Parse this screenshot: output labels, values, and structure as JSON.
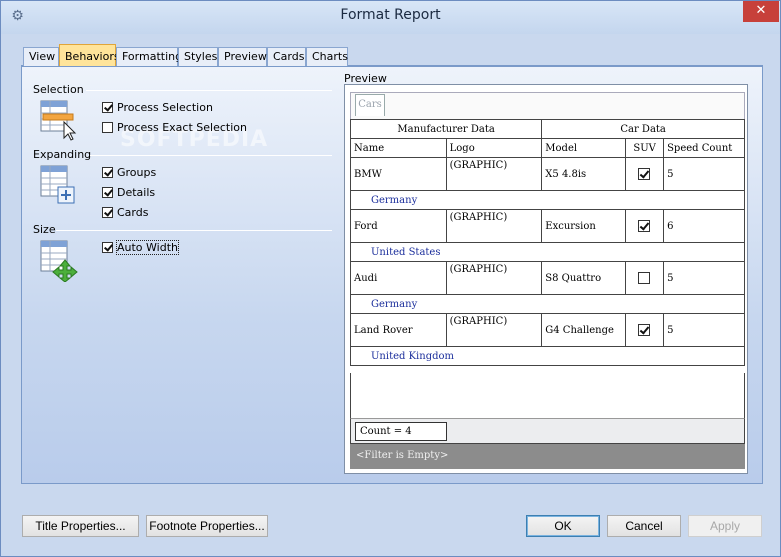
{
  "window": {
    "title": "Format Report",
    "close_label": "✕"
  },
  "tabs": [
    {
      "label": "View",
      "active": false
    },
    {
      "label": "Behaviors",
      "active": true
    },
    {
      "label": "Formatting",
      "active": false
    },
    {
      "label": "Styles",
      "active": false
    },
    {
      "label": "Preview",
      "active": false
    },
    {
      "label": "Cards",
      "active": false
    },
    {
      "label": "Charts",
      "active": false
    }
  ],
  "watermark": "SOFTPEDIA",
  "behaviors": {
    "selection": {
      "label": "Selection",
      "options": [
        {
          "label": "Process Selection",
          "checked": true
        },
        {
          "label": "Process Exact Selection",
          "checked": false
        }
      ]
    },
    "expanding": {
      "label": "Expanding",
      "options": [
        {
          "label": "Groups",
          "checked": true
        },
        {
          "label": "Details",
          "checked": true
        },
        {
          "label": "Cards",
          "checked": true
        }
      ]
    },
    "size": {
      "label": "Size",
      "options": [
        {
          "label": "Auto Width",
          "checked": true
        }
      ]
    }
  },
  "preview": {
    "label": "Preview",
    "card_tab": "Cars",
    "group_headers": [
      "Manufacturer Data",
      "Car Data"
    ],
    "columns": [
      "Name",
      "Logo",
      "Model",
      "SUV",
      "Speed Count"
    ],
    "rows": [
      {
        "name": "BMW",
        "logo": "(GRAPHIC)",
        "model": "X5 4.8is",
        "suv": true,
        "speed_count": "5",
        "country": "Germany"
      },
      {
        "name": "Ford",
        "logo": "(GRAPHIC)",
        "model": "Excursion",
        "suv": true,
        "speed_count": "6",
        "country": "United States"
      },
      {
        "name": "Audi",
        "logo": "(GRAPHIC)",
        "model": "S8 Quattro",
        "suv": false,
        "speed_count": "5",
        "country": "Germany"
      },
      {
        "name": "Land Rover",
        "logo": "(GRAPHIC)",
        "model": "G4 Challenge",
        "suv": true,
        "speed_count": "5",
        "country": "United Kingdom"
      }
    ],
    "count_text": "Count = 4",
    "filter_text": "<Filter is Empty>"
  },
  "buttons": {
    "title_properties": "Title Properties...",
    "footnote_properties": "Footnote Properties...",
    "ok": "OK",
    "cancel": "Cancel",
    "apply": "Apply"
  },
  "colors": {
    "active_tab": "#ffe49a",
    "close_button": "#c7403a",
    "country_text": "#1c2f9c",
    "filter_bar": "#8c8c8c"
  }
}
